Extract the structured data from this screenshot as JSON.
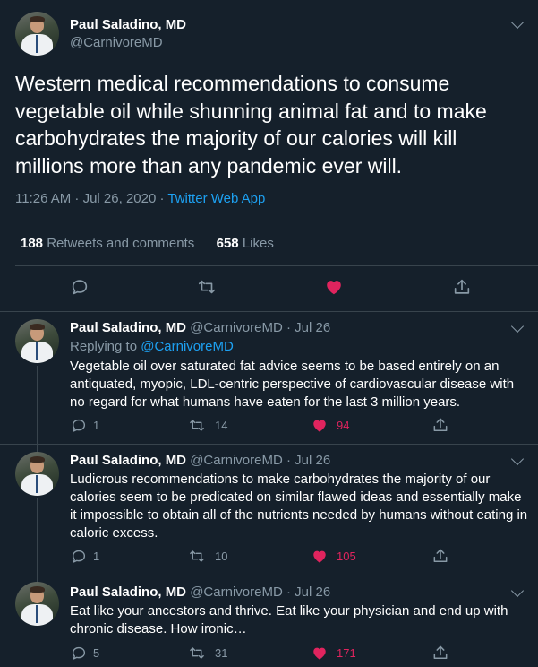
{
  "main": {
    "author_name": "Paul Saladino, MD",
    "author_handle": "@CarnivoreMD",
    "text": "Western medical recommendations to consume vegetable oil while shunning animal fat and to make carbohydrates the majority of our calories will kill millions more than any pandemic ever will.",
    "timestamp": "11:26 AM · Jul 26, 2020 · ",
    "source": "Twitter Web App",
    "retweets_count": "188",
    "retweets_label": "Retweets and comments",
    "likes_count": "658",
    "likes_label": "Likes"
  },
  "replies": [
    {
      "name": "Paul Saladino, MD",
      "handle": "@CarnivoreMD",
      "date": "· Jul 26",
      "replying_prefix": "Replying to ",
      "replying_to": "@CarnivoreMD",
      "text": "Vegetable oil over saturated fat advice seems to be based entirely on an antiquated, myopic, LDL-centric perspective of cardiovascular disease with no regard for what humans have eaten for the last 3 million years.",
      "replies": "1",
      "retweets": "14",
      "likes": "94"
    },
    {
      "name": "Paul Saladino, MD",
      "handle": "@CarnivoreMD",
      "date": "· Jul 26",
      "text": "Ludicrous recommendations to make carbohydrates the majority of our calories seem to be predicated on similar flawed ideas and essentially make it impossible to obtain all of the nutrients needed by humans without eating in caloric excess.",
      "replies": "1",
      "retweets": "10",
      "likes": "105"
    },
    {
      "name": "Paul Saladino, MD",
      "handle": "@CarnivoreMD",
      "date": "· Jul 26",
      "text": "Eat like your ancestors and thrive. Eat like your physician and end up with chronic disease. How ironic…",
      "replies": "5",
      "retweets": "31",
      "likes": "171"
    }
  ],
  "icons": {
    "reply": "comment-icon",
    "retweet": "retweet-icon",
    "like": "heart-icon",
    "share": "share-icon",
    "more": "chevron-down-icon"
  },
  "colors": {
    "background": "#15202b",
    "muted": "#8899a6",
    "link": "#1da1f2",
    "like": "#e0245e",
    "divider": "#38444d"
  }
}
